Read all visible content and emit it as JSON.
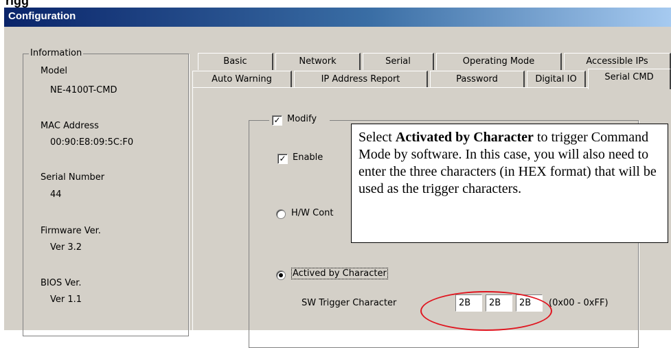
{
  "window": {
    "title": "Configuration"
  },
  "cut_text": "rigg",
  "info": {
    "legend": "Information",
    "model_label": "Model",
    "model_value": "NE-4100T-CMD",
    "mac_label": "MAC Address",
    "mac_value": "00:90:E8:09:5C:F0",
    "serial_label": "Serial Number",
    "serial_value": "44",
    "firmware_label": "Firmware Ver.",
    "firmware_value": "Ver 3.2",
    "bios_label": "BIOS Ver.",
    "bios_value": "Ver 1.1"
  },
  "tabs_row1": [
    "Basic",
    "Network",
    "Serial",
    "Operating Mode",
    "Accessible IPs"
  ],
  "tabs_row2": [
    "Auto Warning",
    "IP Address Report",
    "Password",
    "Digital IO",
    "Serial CMD"
  ],
  "active_tab": "Serial CMD",
  "panel": {
    "modify_label": "Modify",
    "modify_checked": true,
    "enable_label": "Enable",
    "enable_checked": true,
    "hw_label": "H/W Cont",
    "char_label": "Actived by Character",
    "char_selected": true,
    "sw_trigger_label": "SW Trigger Character",
    "trigger_values": [
      "2B",
      "2B",
      "2B"
    ],
    "range_text": "(0x00 - 0xFF)"
  },
  "callout": {
    "text_before": "Select ",
    "bold": "Activated by Character",
    "text_after": " to trigger Command Mode by software. In this case, you will also need to enter the three characters (in HEX format) that will be used as the trigger characters."
  },
  "colors": {
    "dialog_bg": "#d4d0c8",
    "titlebar_start": "#0a246a",
    "titlebar_end": "#a6caf0",
    "highlight_ellipse": "#e0141e"
  }
}
